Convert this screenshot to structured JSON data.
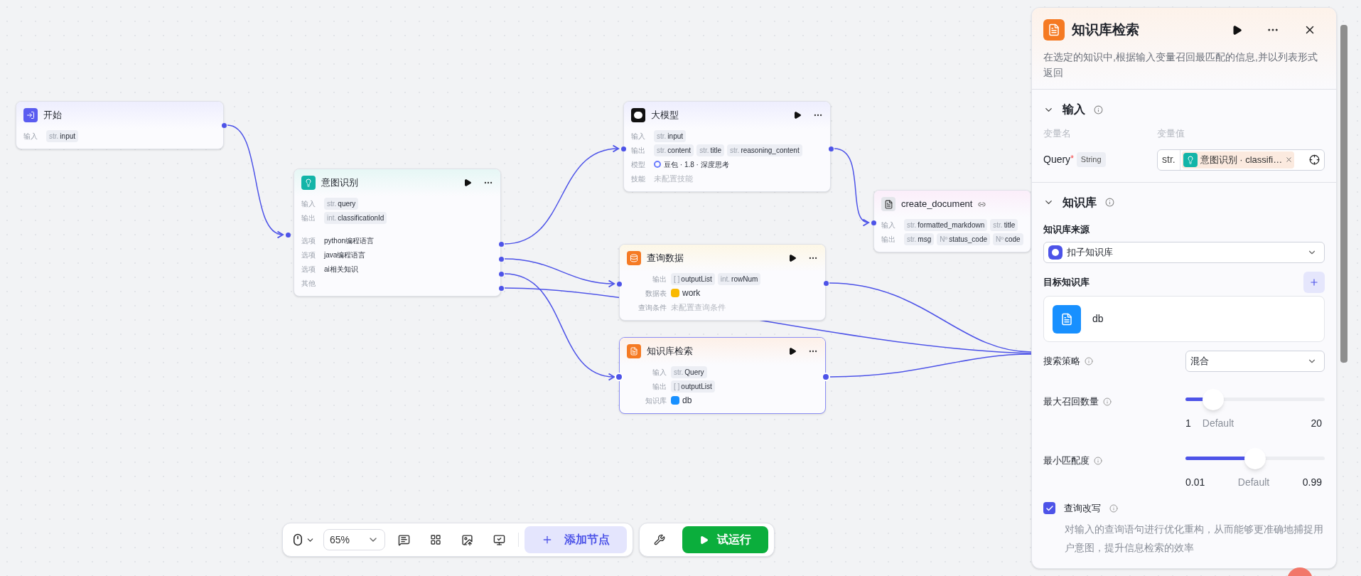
{
  "nodes": [
    {
      "title": "开始",
      "kind": "start",
      "actions": false,
      "selected": false,
      "rows": [
        {
          "label": "输入",
          "kind": "vars",
          "vars": [
            {
              "type": "str.",
              "name": "input"
            }
          ]
        }
      ]
    },
    {
      "title": "意图识别",
      "kind": "intent",
      "actions": true,
      "selected": false,
      "rows": [
        {
          "label": "输入",
          "kind": "vars",
          "vars": [
            {
              "type": "str.",
              "name": "query"
            }
          ]
        },
        {
          "label": "输出",
          "kind": "vars",
          "vars": [
            {
              "type": "int.",
              "name": "classificationId"
            }
          ]
        },
        {
          "label": "选项",
          "kind": "option",
          "text": "python编程语言"
        },
        {
          "label": "选项",
          "kind": "option",
          "text": "java编程语言"
        },
        {
          "label": "选项",
          "kind": "option",
          "text": "ai相关知识"
        },
        {
          "label": "其他",
          "kind": "option"
        }
      ]
    },
    {
      "title": "大模型",
      "kind": "llm",
      "actions": true,
      "selected": false,
      "rows": [
        {
          "label": "输入",
          "kind": "vars",
          "vars": [
            {
              "type": "str.",
              "name": "input"
            }
          ]
        },
        {
          "label": "输出",
          "kind": "vars",
          "vars": [
            {
              "type": "str.",
              "name": "content"
            },
            {
              "type": "str.",
              "name": "title"
            },
            {
              "type": "str.",
              "name": "reasoning_content"
            }
          ]
        },
        {
          "label": "模型",
          "kind": "model",
          "text": "豆包 · 1.8 · 深度思考"
        },
        {
          "label": "技能",
          "kind": "placeholder",
          "text": "未配置技能"
        }
      ]
    },
    {
      "title": "create_document",
      "kind": "tool",
      "actions": false,
      "selected": false,
      "rows": [
        {
          "label": "输入",
          "kind": "vars",
          "vars": [
            {
              "type": "str.",
              "name": "formatted_markdown"
            },
            {
              "type": "str.",
              "name": "title"
            }
          ]
        },
        {
          "label": "输出",
          "kind": "vars",
          "vars": [
            {
              "type": "str.",
              "name": "msg"
            },
            {
              "type": "Nº",
              "name": "status_code"
            },
            {
              "type": "Nº",
              "name": "code"
            }
          ]
        }
      ]
    },
    {
      "title": "查询数据",
      "kind": "db",
      "actions": true,
      "selected": false,
      "rows": [
        {
          "label": "输出",
          "kind": "vars",
          "vars": [
            {
              "type": "[ ]",
              "name": "outputList"
            },
            {
              "type": "int.",
              "name": "rowNum"
            }
          ]
        },
        {
          "label": "数据表",
          "kind": "table",
          "text": "work"
        },
        {
          "label": "查询条件",
          "kind": "placeholder",
          "text": "未配置查询条件"
        }
      ]
    },
    {
      "title": "知识库检索",
      "kind": "kb",
      "actions": true,
      "selected": true,
      "rows": [
        {
          "label": "输入",
          "kind": "vars",
          "vars": [
            {
              "type": "str.",
              "name": "Query"
            }
          ]
        },
        {
          "label": "输出",
          "kind": "vars",
          "vars": [
            {
              "type": "[ ]",
              "name": "outputList"
            }
          ]
        },
        {
          "label": "知识库",
          "kind": "kb",
          "text": "db"
        }
      ]
    }
  ],
  "panel": {
    "title": "知识库检索",
    "description": "在选定的知识中,根据输入变量召回最匹配的信息,并以列表形式返回",
    "input_section": {
      "title": "输入",
      "expanded": true,
      "columns": [
        "变量名",
        "变量值"
      ],
      "param": {
        "name": "Query",
        "required_mark": "*",
        "type": "String",
        "value_prefix": "str.",
        "reference": "意图识别 · classifi…"
      }
    },
    "kb_section": {
      "title": "知识库",
      "expanded": true,
      "source_label": "知识库来源",
      "source_value": "扣子知识库",
      "target_label": "目标知识库",
      "target_item": "db",
      "strategy": {
        "label": "搜索策略",
        "value": "混合"
      },
      "sliders": [
        {
          "label": "最大召回数量",
          "level": 0.2,
          "min": "1",
          "default": "Default",
          "max": "20"
        },
        {
          "label": "最小匹配度",
          "level": 0.5,
          "min": "0.01",
          "default": "Default",
          "max": "0.99"
        }
      ],
      "rewrite": {
        "label": "查询改写",
        "checked": true,
        "description": "对输入的查询语句进行优化重构，从而能够更准确地捕捉用户意图，提升信息检索的效率"
      }
    }
  },
  "toolbar": {
    "zoom": "65%",
    "add_node": "添加节点",
    "test_run": "试运行"
  }
}
